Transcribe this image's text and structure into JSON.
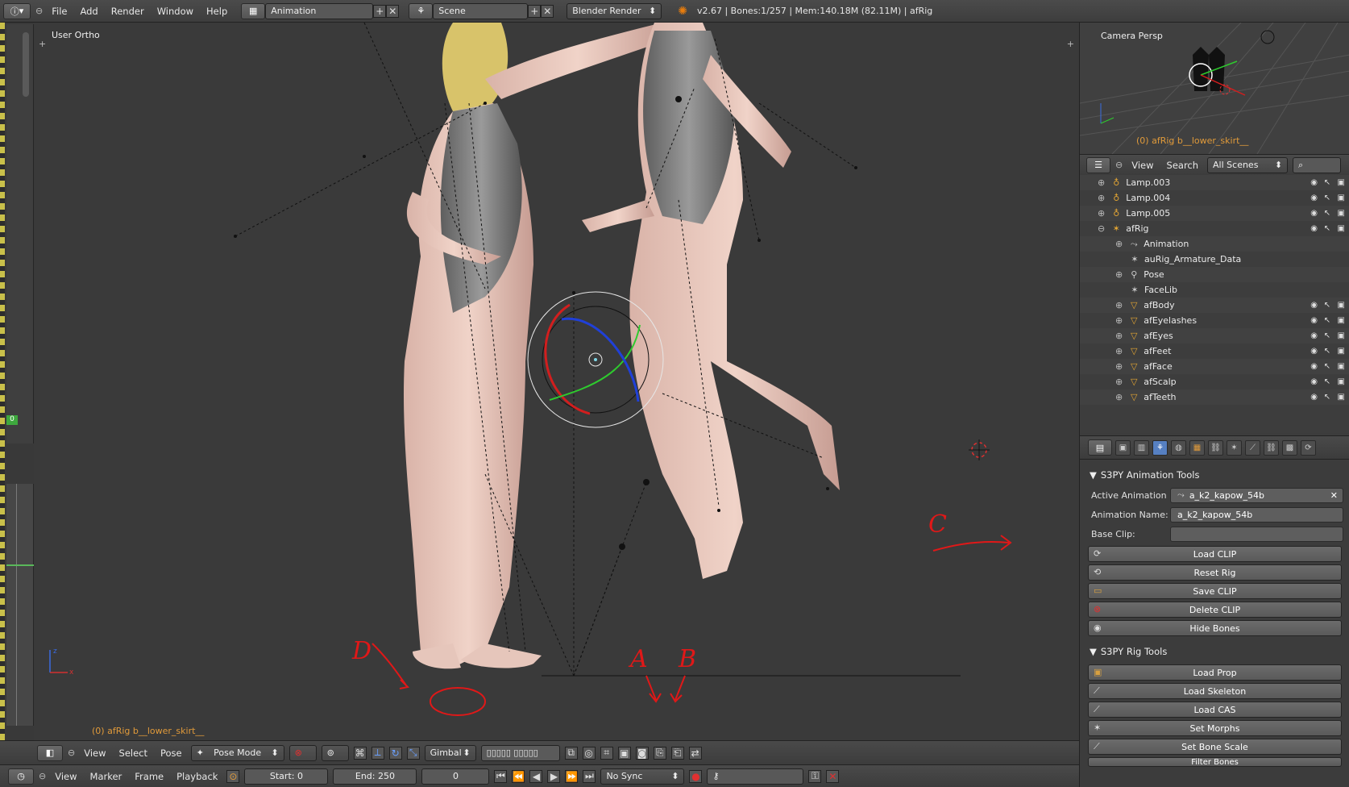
{
  "topbar": {
    "menus": [
      "File",
      "Add",
      "Render",
      "Window",
      "Help"
    ],
    "screen_layout": "Animation",
    "scene": "Scene",
    "render_engine": "Blender Render",
    "status": "v2.67 | Bones:1/257 | Mem:140.18M (82.11M) | afRig"
  },
  "viewport": {
    "view_label": "User Ortho",
    "object_label": "(0) afRig b__lower_skirt__"
  },
  "viewport_header": {
    "menus": [
      "View",
      "Select",
      "Pose"
    ],
    "mode": "Pose Mode",
    "orientation": "Gimbal"
  },
  "timeline_header": {
    "menus": [
      "View",
      "Marker",
      "Frame",
      "Playback"
    ],
    "start": "Start: 0",
    "end": "End: 250",
    "current_frame": "0",
    "sync": "No Sync",
    "current_frame_small": "0"
  },
  "camera_view": {
    "label": "Camera Persp",
    "object_label": "(0) afRig b__lower_skirt__"
  },
  "outliner": {
    "menus": [
      "View",
      "Search"
    ],
    "filter": "All Scenes",
    "rows": [
      {
        "name": "Lamp.003",
        "icon": "lamp-icon",
        "indent": 1
      },
      {
        "name": "Lamp.004",
        "icon": "lamp-icon",
        "indent": 1
      },
      {
        "name": "Lamp.005",
        "icon": "lamp-icon",
        "indent": 1
      },
      {
        "name": "afRig",
        "icon": "armature-icon",
        "indent": 1
      },
      {
        "name": "Animation",
        "icon": "action-icon",
        "indent": 2
      },
      {
        "name": "auRig_Armature_Data",
        "icon": "armature-data-icon",
        "indent": 2
      },
      {
        "name": "Pose",
        "icon": "pose-icon",
        "indent": 2
      },
      {
        "name": "FaceLib",
        "icon": "pose-library-icon",
        "indent": 2
      },
      {
        "name": "afBody",
        "icon": "mesh-icon",
        "indent": 2
      },
      {
        "name": "afEyelashes",
        "icon": "mesh-icon",
        "indent": 2
      },
      {
        "name": "afEyes",
        "icon": "mesh-icon",
        "indent": 2
      },
      {
        "name": "afFeet",
        "icon": "mesh-icon",
        "indent": 2
      },
      {
        "name": "afFace",
        "icon": "mesh-icon",
        "indent": 2
      },
      {
        "name": "afScalp",
        "icon": "mesh-icon",
        "indent": 2
      },
      {
        "name": "afTeeth",
        "icon": "mesh-icon",
        "indent": 2
      }
    ]
  },
  "properties": {
    "animation_tools": {
      "title": "S3PY Animation Tools",
      "active_animation_label": "Active Animation",
      "active_animation_value": "a_k2_kapow_54b",
      "animation_name_label": "Animation Name:",
      "animation_name_value": "a_k2_kapow_54b",
      "base_clip_label": "Base Clip:",
      "base_clip_value": "",
      "buttons": [
        "Load CLIP",
        "Reset Rig",
        "Save CLIP",
        "Delete CLIP",
        "Hide Bones"
      ]
    },
    "rig_tools": {
      "title": "S3PY Rig Tools",
      "buttons": [
        "Load Prop",
        "Load Skeleton",
        "Load CAS",
        "Set Morphs",
        "Set Bone Scale",
        "Filter Bones"
      ]
    }
  },
  "annotations": {
    "a": "A",
    "b": "B",
    "c": "C",
    "d": "D"
  },
  "colors": {
    "annotation": "#e01818",
    "active_object_text": "#e09a3a",
    "properties_active_tab": "#5680c2"
  }
}
